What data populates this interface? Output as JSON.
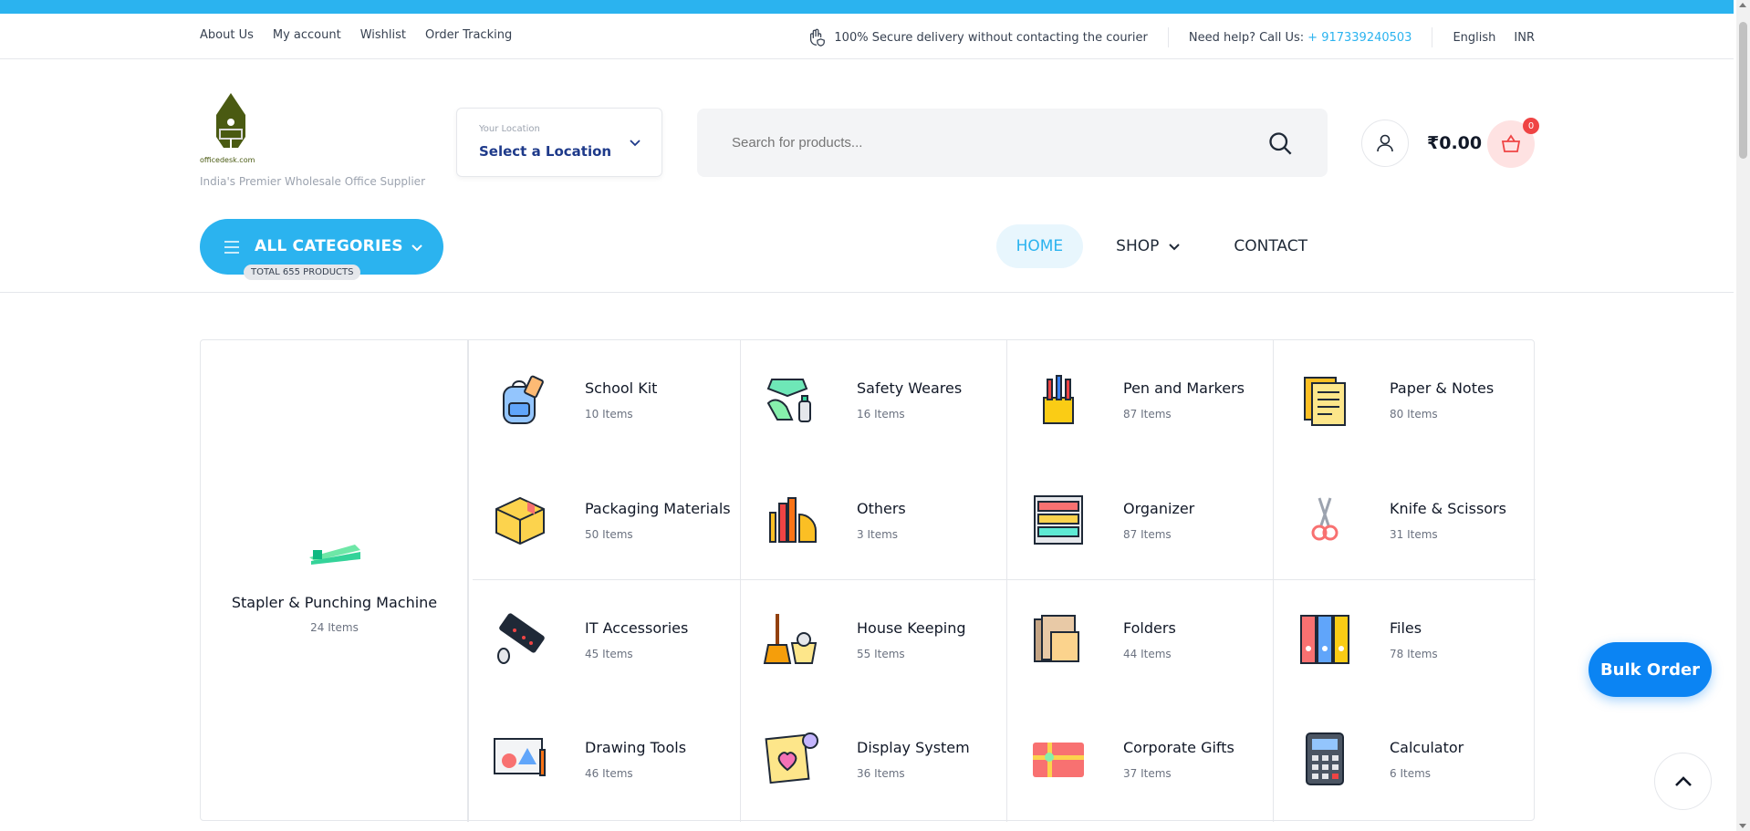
{
  "topbar": {
    "links": [
      "About Us",
      "My account",
      "Wishlist",
      "Order Tracking"
    ],
    "secure_text": "100% Secure delivery without contacting the courier",
    "help_text": "Need help? Call Us:",
    "phone": "+ 917339240503",
    "language": "English",
    "currency": "INR"
  },
  "header": {
    "logo_text": "officedesk.com",
    "tagline": "India's Premier Wholesale Office Supplier",
    "location_label": "Your Location",
    "location_value": "Select a Location",
    "search_placeholder": "Search for products...",
    "cart_total": "₹0.00",
    "cart_count": "0"
  },
  "categories_button": {
    "label": "ALL CATEGORIES",
    "total": "TOTAL 655 PRODUCTS"
  },
  "nav": {
    "home": "HOME",
    "shop": "SHOP",
    "contact": "CONTACT"
  },
  "featured_category": {
    "name": "Stapler & Punching Machine",
    "count": "24 Items",
    "icon": "stapler-icon"
  },
  "categories": [
    {
      "name": "School Kit",
      "count": "10 Items",
      "icon": "backpack-icon"
    },
    {
      "name": "Safety Weares",
      "count": "16 Items",
      "icon": "mask-gloves-icon"
    },
    {
      "name": "Pen and Markers",
      "count": "87 Items",
      "icon": "pen-holder-icon"
    },
    {
      "name": "Paper & Notes",
      "count": "80 Items",
      "icon": "paper-icon"
    },
    {
      "name": "Packaging Materials",
      "count": "50 Items",
      "icon": "box-icon"
    },
    {
      "name": "Others",
      "count": "3 Items",
      "icon": "ruler-pencil-icon"
    },
    {
      "name": "Organizer",
      "count": "87 Items",
      "icon": "tray-organizer-icon"
    },
    {
      "name": "Knife & Scissors",
      "count": "31 Items",
      "icon": "scissors-icon"
    },
    {
      "name": "IT Accessories",
      "count": "45 Items",
      "icon": "keyboard-mouse-icon"
    },
    {
      "name": "House Keeping",
      "count": "55 Items",
      "icon": "broom-bucket-icon"
    },
    {
      "name": "Folders",
      "count": "44 Items",
      "icon": "folder-icon"
    },
    {
      "name": "Files",
      "count": "78 Items",
      "icon": "binders-icon"
    },
    {
      "name": "Drawing Tools",
      "count": "46 Items",
      "icon": "drawing-board-icon"
    },
    {
      "name": "Display System",
      "count": "36 Items",
      "icon": "heart-board-icon"
    },
    {
      "name": "Corporate Gifts",
      "count": "37 Items",
      "icon": "gift-card-icon"
    },
    {
      "name": "Calculator",
      "count": "6 Items",
      "icon": "calculator-icon"
    }
  ],
  "floating": {
    "bulk_order": "Bulk Order"
  },
  "colors": {
    "accent": "#2bb3ef",
    "bulk": "#0b84f3",
    "cart_badge": "#ef4444",
    "brand_olive": "#4a5a12"
  }
}
